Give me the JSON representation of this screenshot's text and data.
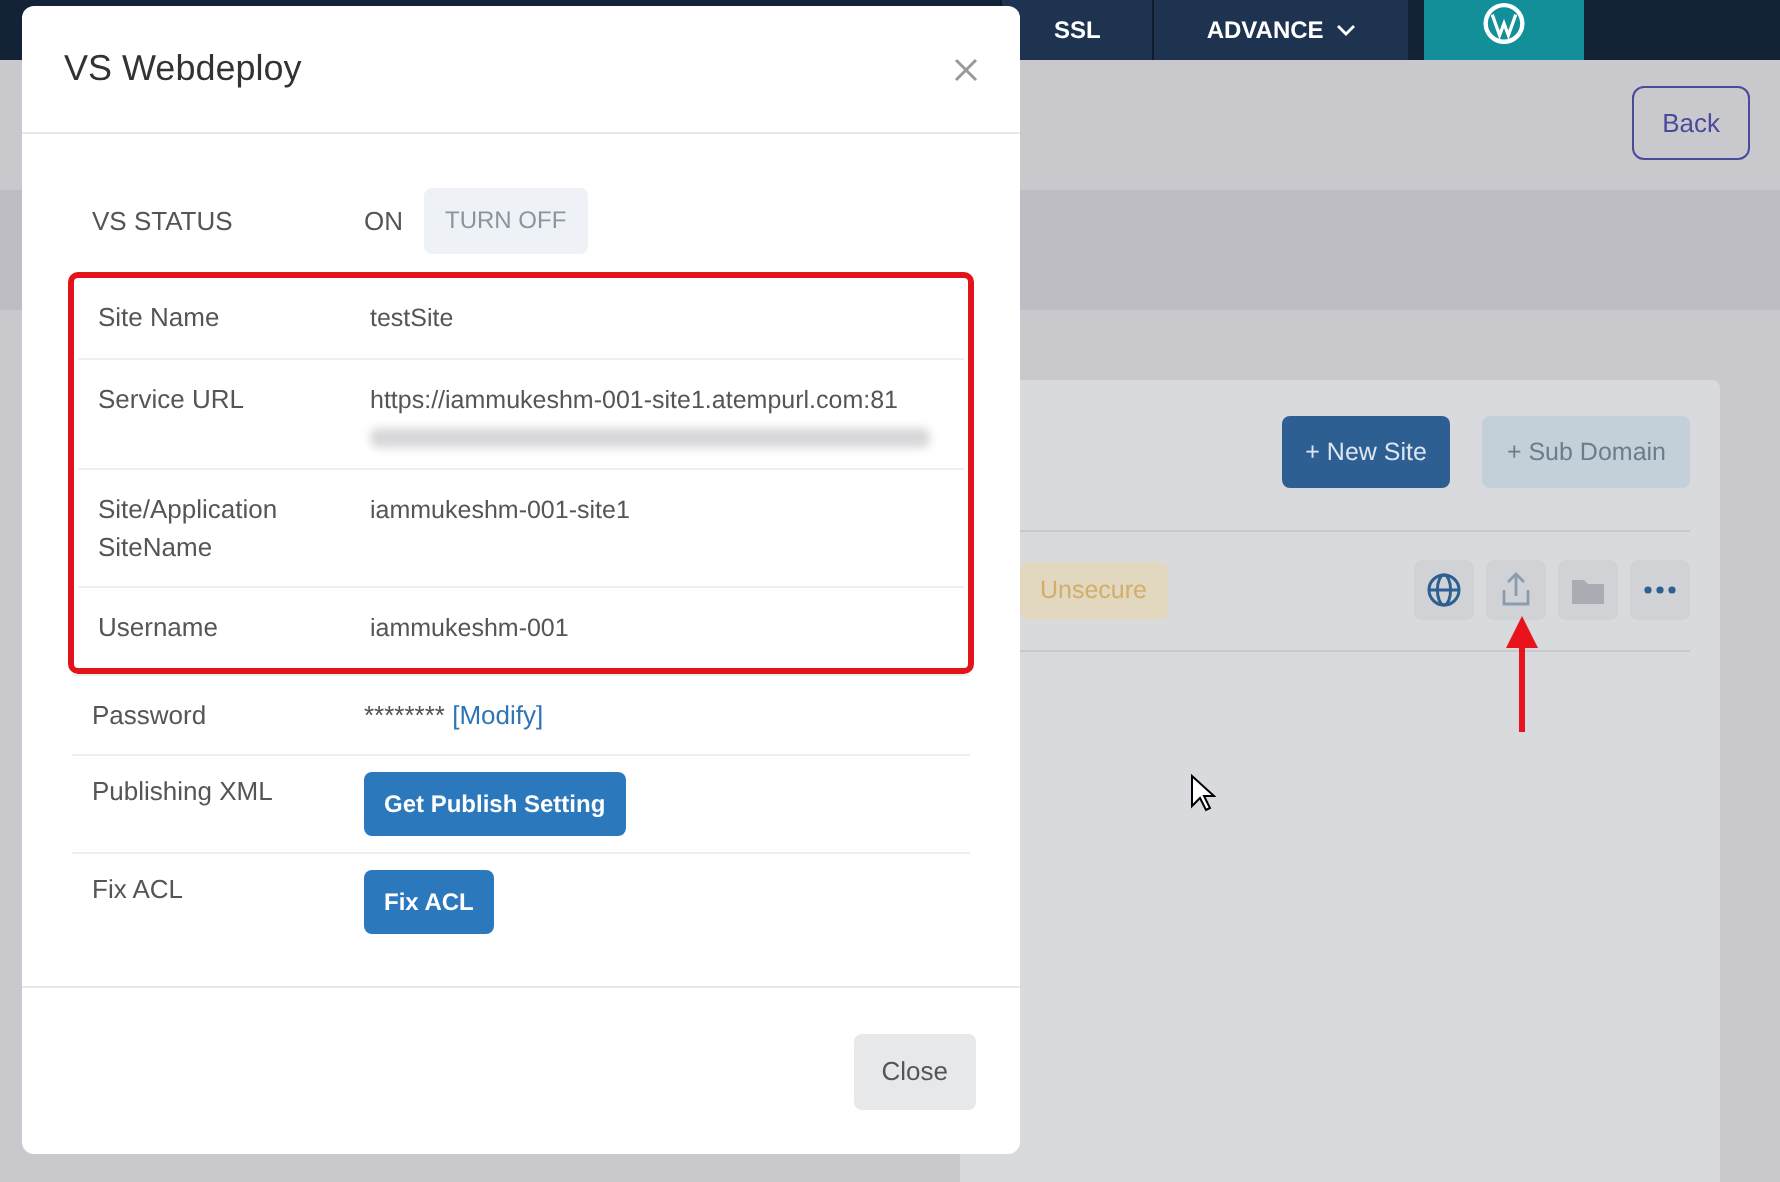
{
  "top_nav": {
    "tabs": [
      {
        "label": "SSL"
      },
      {
        "label": "ADVANCE",
        "dropdown": true
      }
    ]
  },
  "page": {
    "back_button": "Back",
    "new_site_button": "+ New Site",
    "sub_domain_button": "+ Sub Domain",
    "site_row": {
      "badge": "Unsecure"
    }
  },
  "dialog": {
    "title": "VS Webdeploy",
    "rows": [
      {
        "kind": "status",
        "label": "VS STATUS",
        "value": "ON",
        "action": "TURN OFF",
        "highlighted": false
      },
      {
        "kind": "text",
        "label": "Site Name",
        "value": "testSite",
        "highlighted": true
      },
      {
        "kind": "text",
        "label": "Service URL",
        "value": "https://iammukeshm-001-site1.atempurl.com:81",
        "redacted": true,
        "highlighted": true
      },
      {
        "kind": "text",
        "label": "Site/Application SiteName",
        "value": "iammukeshm-001-site1",
        "highlighted": true
      },
      {
        "kind": "text",
        "label": "Username",
        "value": "iammukeshm-001",
        "highlighted": true
      },
      {
        "kind": "password",
        "label": "Password",
        "value": "********",
        "link": "[Modify]",
        "highlighted": false
      },
      {
        "kind": "button",
        "label": "Publishing XML",
        "action": "Get Publish Setting",
        "highlighted": false
      },
      {
        "kind": "button",
        "label": "Fix ACL",
        "action": "Fix ACL",
        "highlighted": false
      }
    ],
    "close_button": "Close"
  }
}
